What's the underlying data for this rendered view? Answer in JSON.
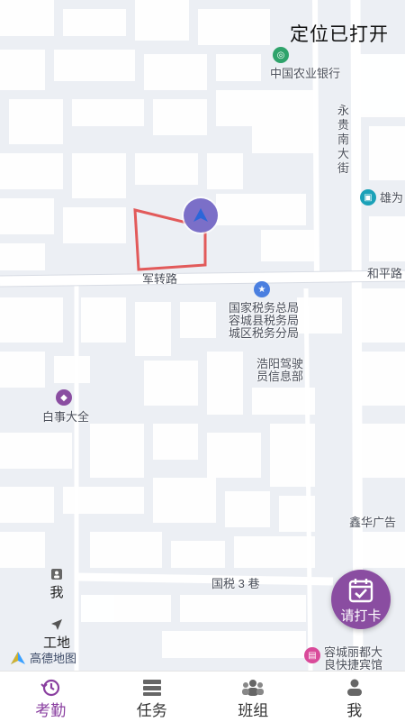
{
  "status": "定位已打开",
  "map": {
    "roads": {
      "junzhuan": "军转路",
      "heping": "和平路",
      "yonggui": "永贵南大街",
      "guoshui": "国税 3 巷"
    },
    "pois": {
      "bank": "中国农业银行",
      "xiongwei": "雄为",
      "tax": "国家税务总局容城县税务局城区税务分局",
      "tax_l1": "国家税务总局",
      "tax_l2": "容城县税务局",
      "tax_l3": "城区税务分局",
      "driving_l1": "浩阳驾驶",
      "driving_l2": "员信息部",
      "baishi": "白事大全",
      "xinhua": "鑫华广告",
      "hotel_l1": "容城丽都大",
      "hotel_l2": "良快捷宾馆"
    },
    "logo": "高德地图"
  },
  "side": {
    "me": "我",
    "site": "工地"
  },
  "clock_button": "请打卡",
  "tabs": [
    {
      "label": "考勤",
      "icon": "clock-history-icon",
      "active": true
    },
    {
      "label": "任务",
      "icon": "task-list-icon",
      "active": false
    },
    {
      "label": "班组",
      "icon": "team-icon",
      "active": false
    },
    {
      "label": "我",
      "icon": "person-icon",
      "active": false
    }
  ],
  "colors": {
    "accent": "#8a4da1",
    "fence": "#e25a5a",
    "location": "#7b6fc8"
  }
}
